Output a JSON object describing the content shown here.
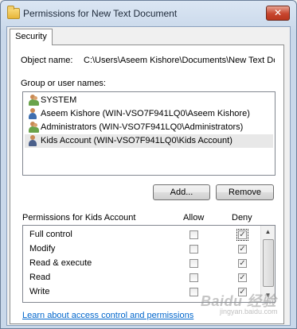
{
  "window": {
    "title": "Permissions for New Text Document",
    "close_glyph": "✕"
  },
  "tabs": [
    {
      "label": "Security",
      "active": true
    }
  ],
  "object": {
    "label": "Object name:",
    "value": "C:\\Users\\Aseem Kishore\\Documents\\New Text Do"
  },
  "groups": {
    "label": "Group or user names:",
    "items": [
      {
        "label": "SYSTEM",
        "icon": "group-icon"
      },
      {
        "label": "Aseem Kishore (WIN-VSO7F941LQ0\\Aseem Kishore)",
        "icon": "user-icon"
      },
      {
        "label": "Administrators (WIN-VSO7F941LQ0\\Administrators)",
        "icon": "group-icon"
      },
      {
        "label": "Kids Account (WIN-VSO7F941LQ0\\Kids Account)",
        "icon": "user-icon",
        "selected": true
      }
    ]
  },
  "buttons": {
    "add": "Add...",
    "remove": "Remove"
  },
  "permissions": {
    "header": "Permissions for Kids Account",
    "allow_header": "Allow",
    "deny_header": "Deny",
    "rows": [
      {
        "label": "Full control",
        "allow": false,
        "deny": true
      },
      {
        "label": "Modify",
        "allow": false,
        "deny": true
      },
      {
        "label": "Read & execute",
        "allow": false,
        "deny": true
      },
      {
        "label": "Read",
        "allow": false,
        "deny": true
      },
      {
        "label": "Write",
        "allow": false,
        "deny": true
      }
    ]
  },
  "link": "Learn about access control and permissions",
  "watermark": {
    "main": "Baidu 经验",
    "sub": "jingyan.baidu.com"
  },
  "colors": {
    "link": "#0066cc",
    "close": "#c7452e",
    "selection": "#e8e8e8"
  }
}
